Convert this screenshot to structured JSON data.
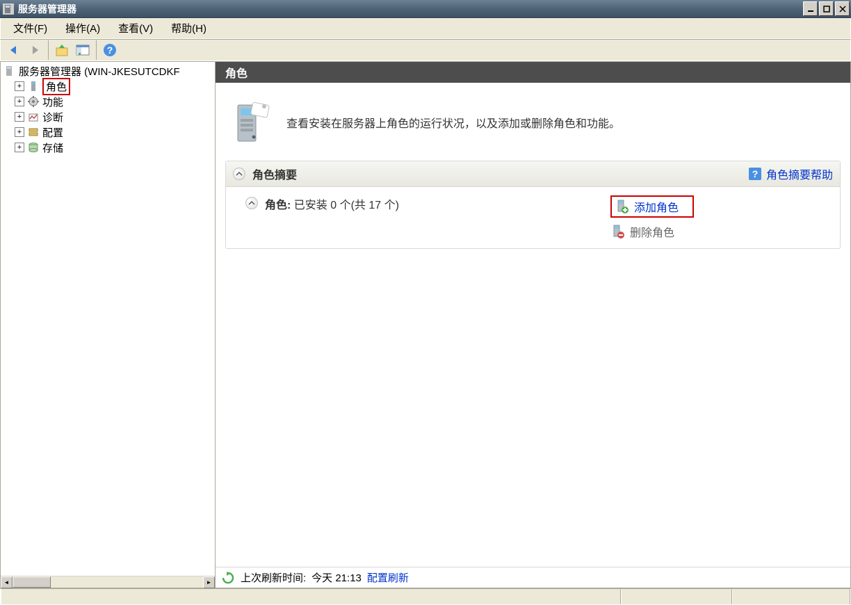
{
  "window": {
    "title": "服务器管理器"
  },
  "menubar": {
    "file": "文件(F)",
    "action": "操作(A)",
    "view": "查看(V)",
    "help": "帮助(H)"
  },
  "tree": {
    "root": "服务器管理器 (WIN-JKESUTCDKF",
    "items": [
      {
        "label": "角色"
      },
      {
        "label": "功能"
      },
      {
        "label": "诊断"
      },
      {
        "label": "配置"
      },
      {
        "label": "存储"
      }
    ]
  },
  "detail": {
    "header": "角色",
    "intro": "查看安装在服务器上角色的运行状况，以及添加或删除角色和功能。",
    "summary_title": "角色摘要",
    "summary_help": "角色摘要帮助",
    "role_label": "角色:",
    "role_stat": "已安装 0 个(共 17 个)",
    "add_role": "添加角色",
    "remove_role": "删除角色",
    "footer_label": "上次刷新时间:",
    "footer_time": "今天 21:13",
    "refresh_config": "配置刷新"
  }
}
